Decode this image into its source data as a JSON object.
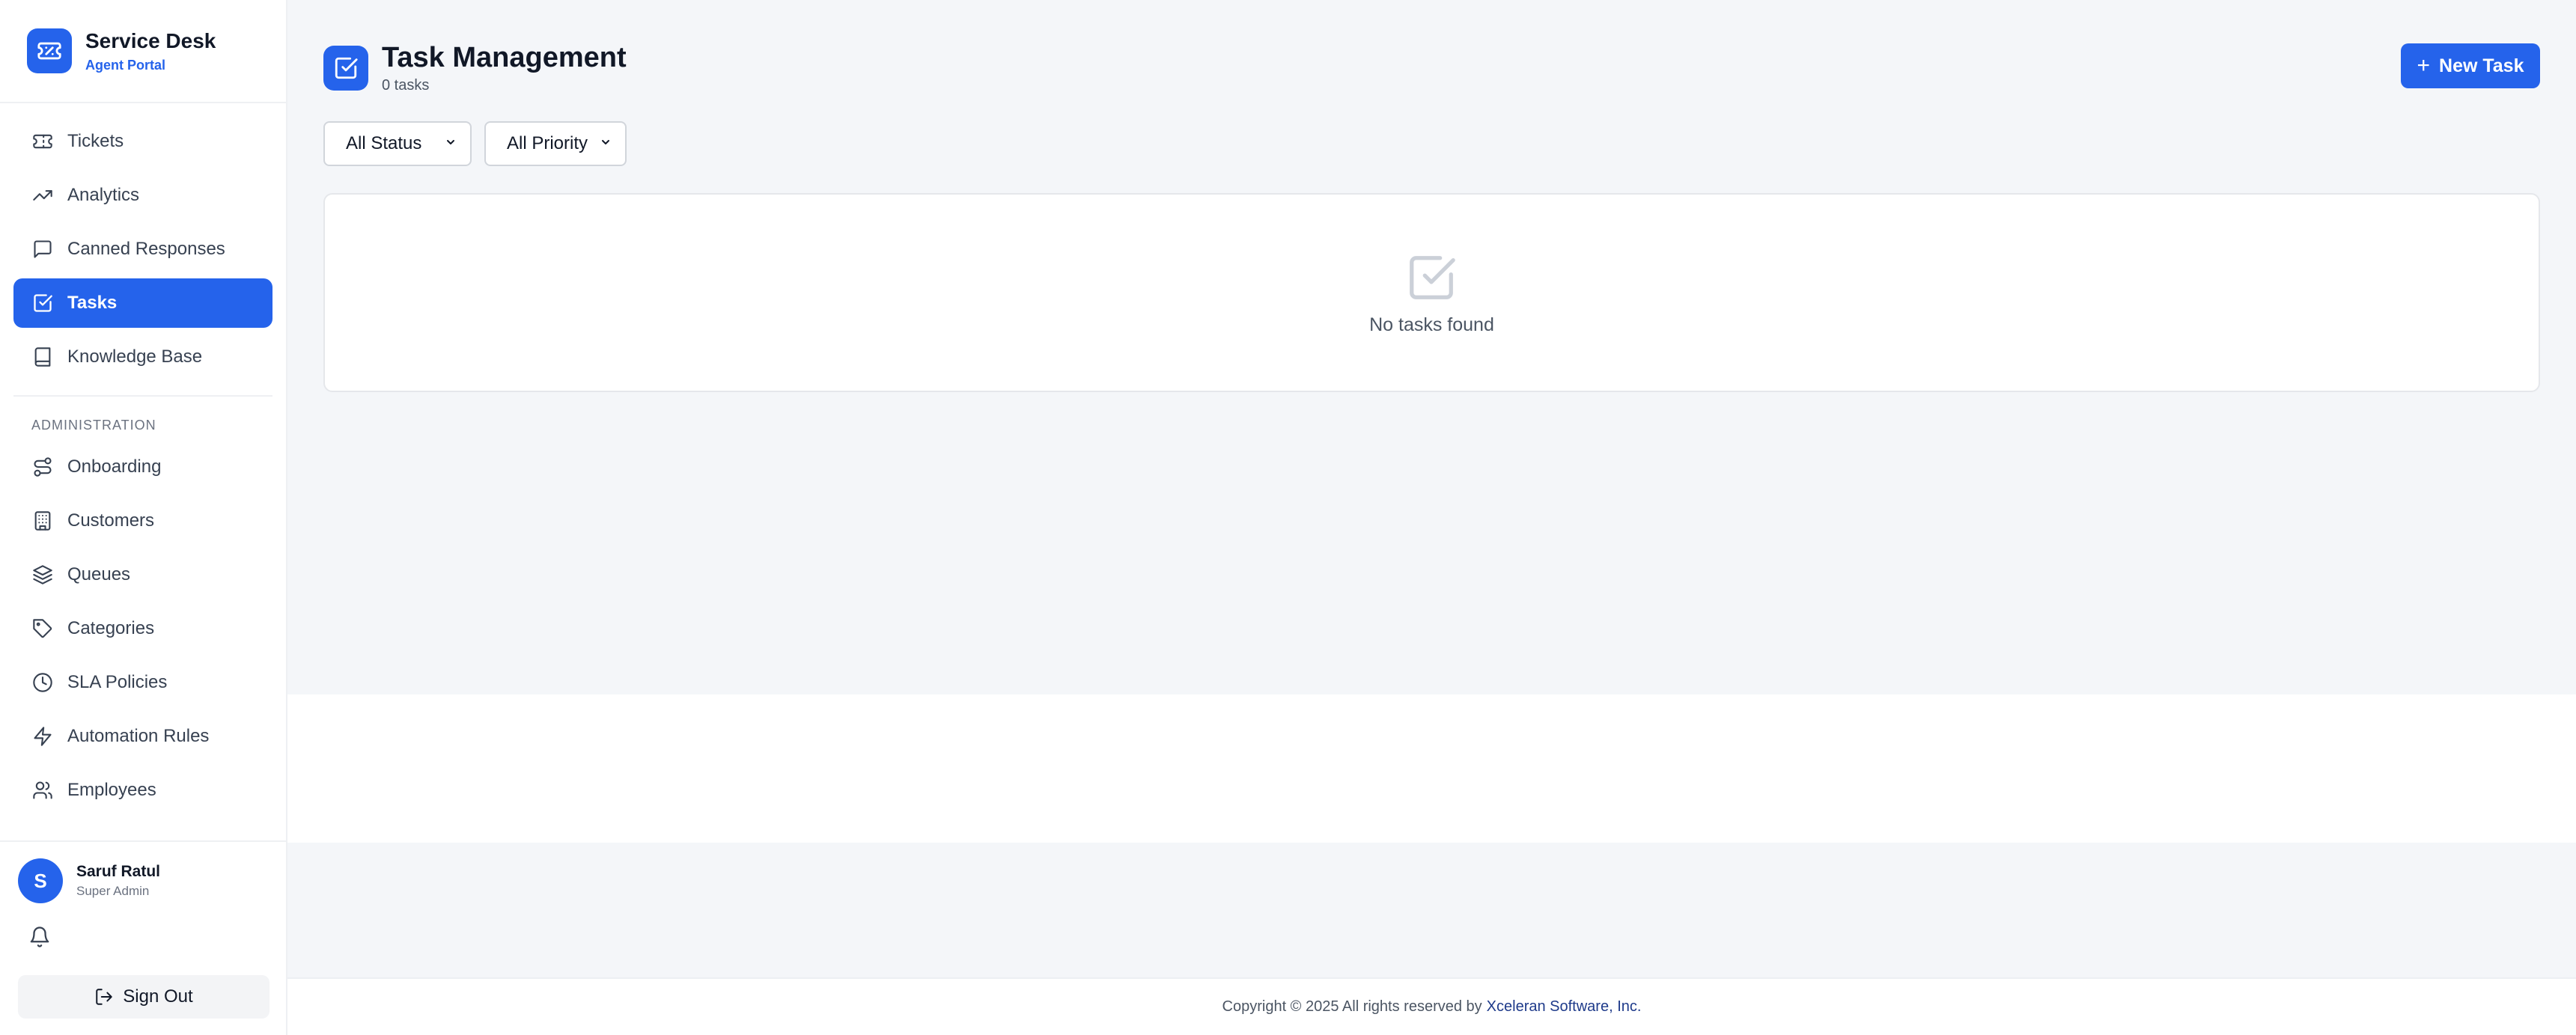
{
  "brand": {
    "title": "Service Desk",
    "subtitle": "Agent Portal"
  },
  "sidebar": {
    "items": [
      {
        "label": "Tickets",
        "icon": "ticket-icon"
      },
      {
        "label": "Analytics",
        "icon": "trending-up-icon"
      },
      {
        "label": "Canned Responses",
        "icon": "message-square-icon"
      },
      {
        "label": "Tasks",
        "icon": "check-square-icon",
        "active": true
      },
      {
        "label": "Knowledge Base",
        "icon": "book-icon"
      }
    ],
    "admin_label": "ADMINISTRATION",
    "admin_items": [
      {
        "label": "Onboarding",
        "icon": "route-icon"
      },
      {
        "label": "Customers",
        "icon": "building-icon"
      },
      {
        "label": "Queues",
        "icon": "layers-icon"
      },
      {
        "label": "Categories",
        "icon": "tag-icon"
      },
      {
        "label": "SLA Policies",
        "icon": "clock-icon"
      },
      {
        "label": "Automation Rules",
        "icon": "zap-icon"
      },
      {
        "label": "Employees",
        "icon": "users-icon"
      }
    ]
  },
  "user": {
    "initial": "S",
    "name": "Saruf Ratul",
    "role": "Super Admin",
    "signout_label": "Sign Out"
  },
  "header": {
    "title": "Task Management",
    "count": "0 tasks",
    "new_task_label": "New Task"
  },
  "filters": {
    "status": "All Status",
    "priority": "All Priority"
  },
  "empty": {
    "message": "No tasks found"
  },
  "footer": {
    "copyright": "Copyright © 2025 All rights reserved by",
    "company": "Xceleran Software, Inc."
  },
  "colors": {
    "accent": "#2563eb",
    "background": "#f4f6f9"
  }
}
